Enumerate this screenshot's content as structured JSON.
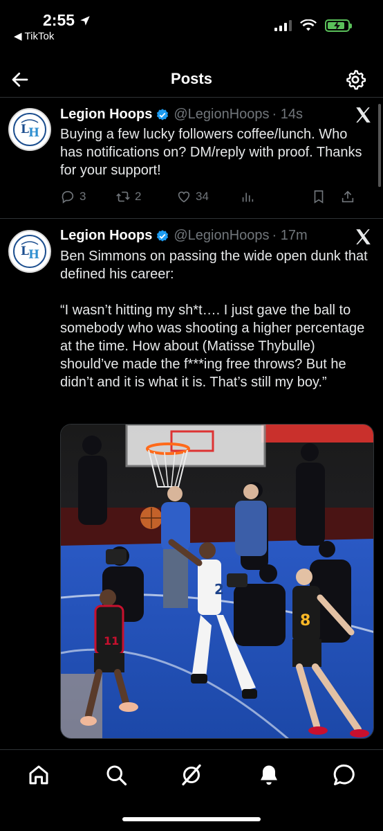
{
  "status_bar": {
    "time": "2:55",
    "back_app_label": "TikTok",
    "battery_level": 0.85
  },
  "header": {
    "title": "Posts",
    "back_icon": "arrow-left-icon",
    "settings_icon": "gear-icon"
  },
  "posts": [
    {
      "name": "Legion Hoops",
      "handle": "@LegionHoops",
      "time": "· 14s",
      "text": "Buying a few lucky followers coffee/lunch. Who has notifications on? DM/reply with proof. Thanks for your support!",
      "replies": "3",
      "reposts": "2",
      "likes": "34"
    },
    {
      "name": "Legion Hoops",
      "handle": "@LegionHoops",
      "time": "· 17m",
      "text": "Ben Simmons on passing the wide open dunk that defined his career:\n\n“I wasn’t hitting my sh*t…. I just gave the ball to somebody who was shooting a higher percentage at the time. How about (Matisse Thybulle) should’ve made the f***ing free throws? But he didn’t and it is what it is. That’s still my boy.”",
      "image_alt": "basketball-game-photo"
    }
  ],
  "tabs": [
    "home-icon",
    "search-icon",
    "grok-icon",
    "bell-icon",
    "messages-icon"
  ],
  "colors": {
    "background": "#000000",
    "text": "#e7e9ea",
    "muted": "#71767b",
    "verified": "#1d9bf0",
    "court": "#1f4fb8"
  }
}
